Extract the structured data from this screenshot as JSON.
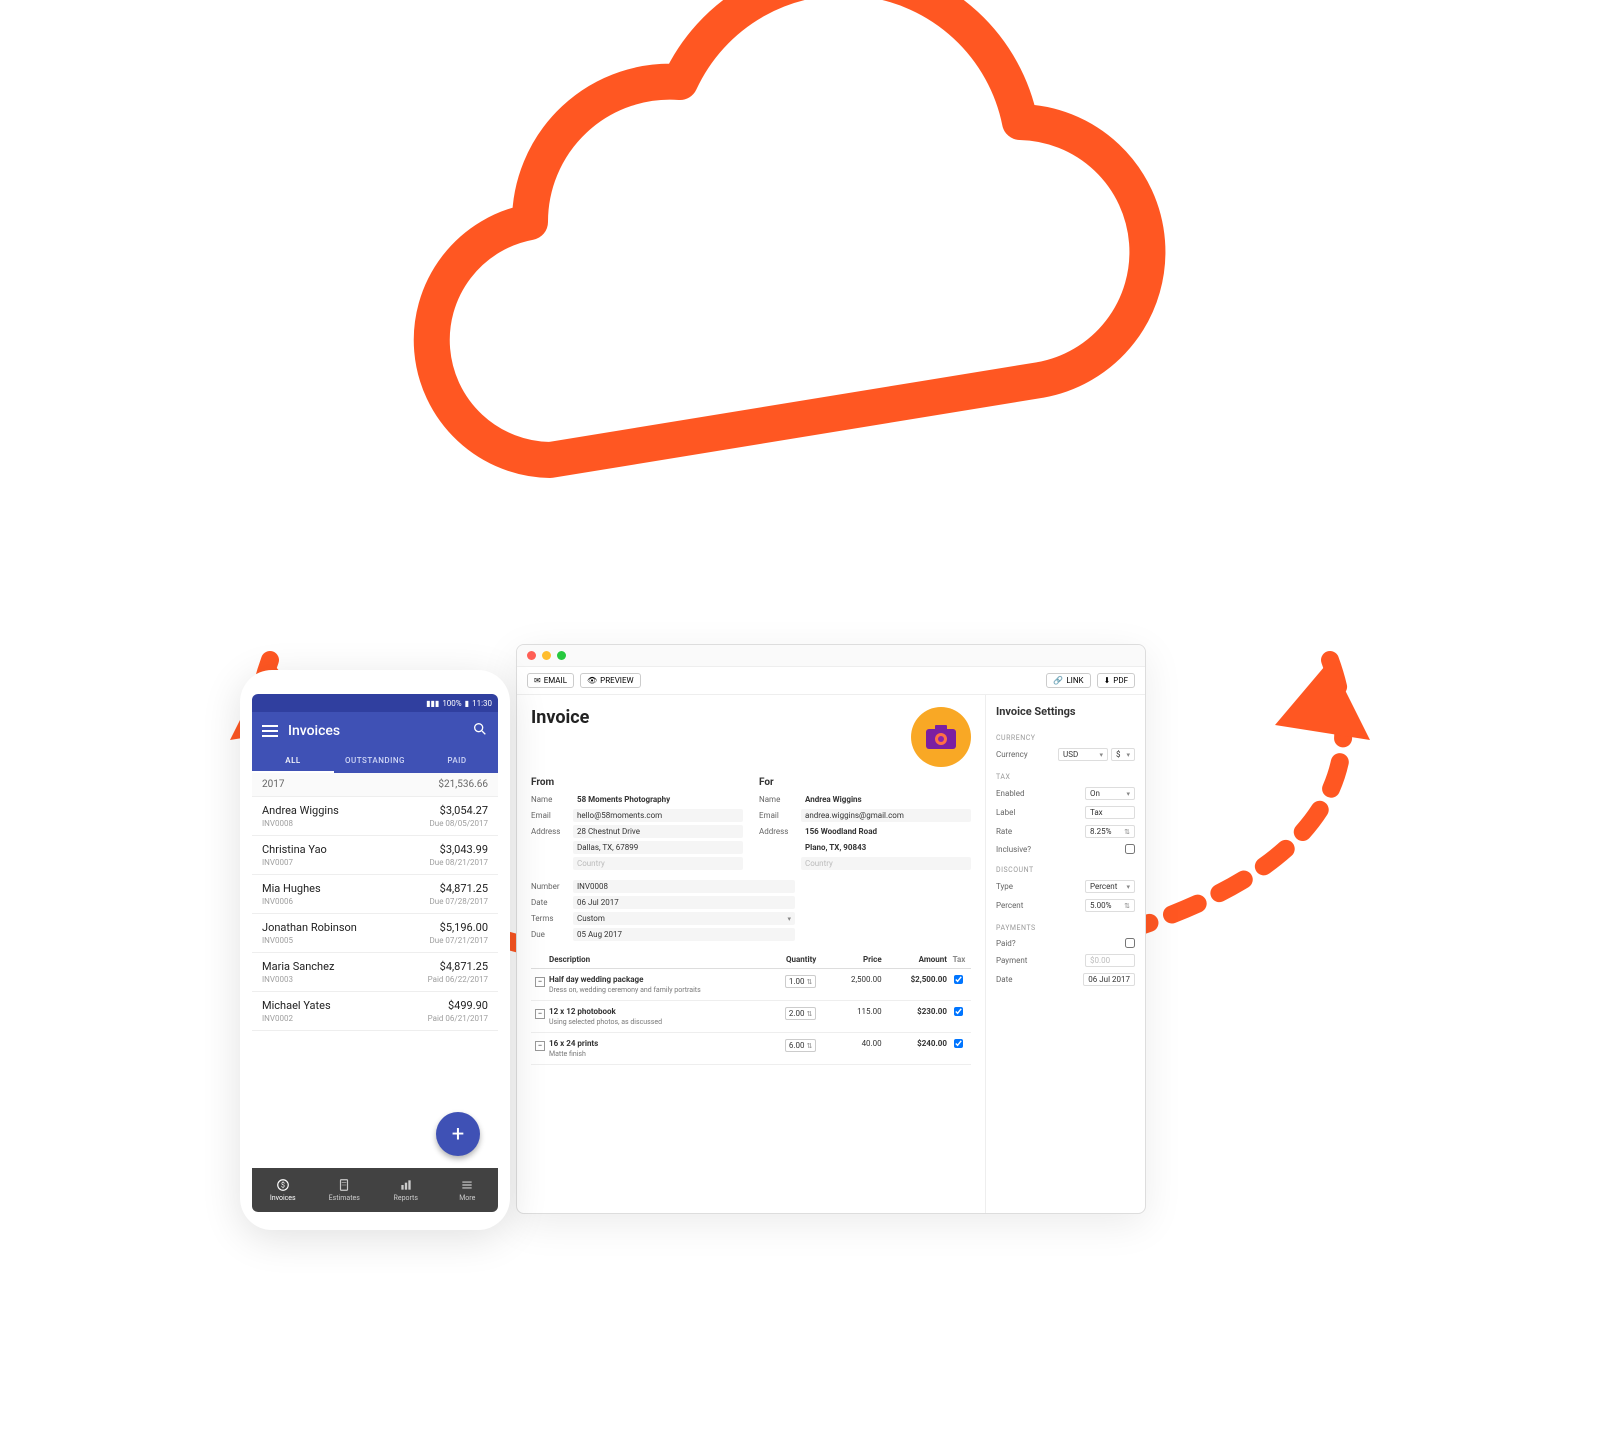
{
  "colors": {
    "accent": "#ff5722",
    "mobile_primary": "#3f51b5"
  },
  "mobile": {
    "statusbar": {
      "signal": "📶",
      "wifi": "📡",
      "battery_pct": "100%",
      "time": "11:30"
    },
    "title": "Invoices",
    "tabs": [
      "ALL",
      "OUTSTANDING",
      "PAID"
    ],
    "active_tab": 0,
    "year_label": "2017",
    "year_total": "$21,536.66",
    "invoices": [
      {
        "name": "Andrea Wiggins",
        "num": "INV0008",
        "amount": "$3,054.27",
        "status": "Due 08/05/2017"
      },
      {
        "name": "Christina Yao",
        "num": "INV0007",
        "amount": "$3,043.99",
        "status": "Due 08/21/2017"
      },
      {
        "name": "Mia Hughes",
        "num": "INV0006",
        "amount": "$4,871.25",
        "status": "Due 07/28/2017"
      },
      {
        "name": "Jonathan Robinson",
        "num": "INV0005",
        "amount": "$5,196.00",
        "status": "Due 07/21/2017"
      },
      {
        "name": "Maria Sanchez",
        "num": "INV0003",
        "amount": "$4,871.25",
        "status": "Paid 06/22/2017"
      },
      {
        "name": "Michael Yates",
        "num": "INV0002",
        "amount": "$499.90",
        "status": "Paid 06/21/2017"
      }
    ],
    "bottom_nav": [
      {
        "icon": "dollar-icon",
        "label": "Invoices"
      },
      {
        "icon": "calculator-icon",
        "label": "Estimates"
      },
      {
        "icon": "chart-icon",
        "label": "Reports"
      },
      {
        "icon": "more-icon",
        "label": "More"
      }
    ]
  },
  "desktop": {
    "toolbar": {
      "email": "EMAIL",
      "preview": "PREVIEW",
      "link": "LINK",
      "pdf": "PDF"
    },
    "title": "Invoice",
    "from_label": "From",
    "for_label": "For",
    "labels": {
      "name": "Name",
      "email": "Email",
      "address": "Address",
      "country": "Country",
      "number": "Number",
      "date": "Date",
      "terms": "Terms",
      "due": "Due"
    },
    "from": {
      "name": "58 Moments Photography",
      "email": "hello@58moments.com",
      "address1": "28 Chestnut Drive",
      "address2": "Dallas, TX, 67899"
    },
    "for": {
      "name": "Andrea Wiggins",
      "email": "andrea.wiggins@gmail.com",
      "address1": "156 Woodland Road",
      "address2": "Plano, TX, 90843"
    },
    "meta": {
      "number": "INV0008",
      "date": "06 Jul 2017",
      "terms": "Custom",
      "due": "05 Aug 2017"
    },
    "columns": {
      "description": "Description",
      "quantity": "Quantity",
      "price": "Price",
      "amount": "Amount",
      "tax": "Tax"
    },
    "items": [
      {
        "title": "Half day wedding package",
        "sub": "Dress on, wedding ceremony and family portraits",
        "qty": "1.00",
        "price": "2,500.00",
        "amount": "$2,500.00"
      },
      {
        "title": "12 x 12 photobook",
        "sub": "Using selected photos, as discussed",
        "qty": "2.00",
        "price": "115.00",
        "amount": "$230.00"
      },
      {
        "title": "16 x 24 prints",
        "sub": "Matte finish",
        "qty": "6.00",
        "price": "40.00",
        "amount": "$240.00"
      }
    ],
    "settings": {
      "title": "Invoice Settings",
      "sections": {
        "currency": {
          "label": "CURRENCY",
          "currency_lbl": "Currency",
          "currency_val": "USD",
          "symbol": "$"
        },
        "tax": {
          "label": "TAX",
          "enabled_lbl": "Enabled",
          "enabled_val": "On",
          "label_lbl": "Label",
          "label_val": "Tax",
          "rate_lbl": "Rate",
          "rate_val": "8.25%",
          "inclusive_lbl": "Inclusive?"
        },
        "discount": {
          "label": "DISCOUNT",
          "type_lbl": "Type",
          "type_val": "Percent",
          "percent_lbl": "Percent",
          "percent_val": "5.00%"
        },
        "payments": {
          "label": "PAYMENTS",
          "paid_lbl": "Paid?",
          "payment_lbl": "Payment",
          "payment_val": "$0.00",
          "date_lbl": "Date",
          "date_val": "06 Jul 2017"
        }
      }
    }
  }
}
